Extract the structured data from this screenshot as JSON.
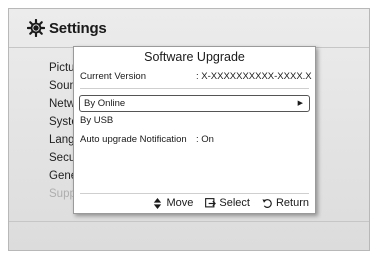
{
  "header": {
    "title": "Settings"
  },
  "menu": {
    "items": [
      {
        "label": "Pictur",
        "dim": false
      },
      {
        "label": "Sounc",
        "dim": false
      },
      {
        "label": "Netwo",
        "dim": false
      },
      {
        "label": "Syste",
        "dim": false
      },
      {
        "label": "Langu",
        "dim": false
      },
      {
        "label": "Secur",
        "dim": false
      },
      {
        "label": "Gener",
        "dim": false
      },
      {
        "label": "Suppo",
        "dim": true
      }
    ]
  },
  "popup": {
    "title": "Software Upgrade",
    "current_version_label": "Current Version",
    "current_version_value": ": X-XXXXXXXXXX-XXXX.X",
    "by_online": "By Online",
    "by_usb": "By USB",
    "auto_label": "Auto upgrade Notification",
    "auto_value": ": On"
  },
  "footer": {
    "move": "Move",
    "select": "Select",
    "return": "Return"
  }
}
